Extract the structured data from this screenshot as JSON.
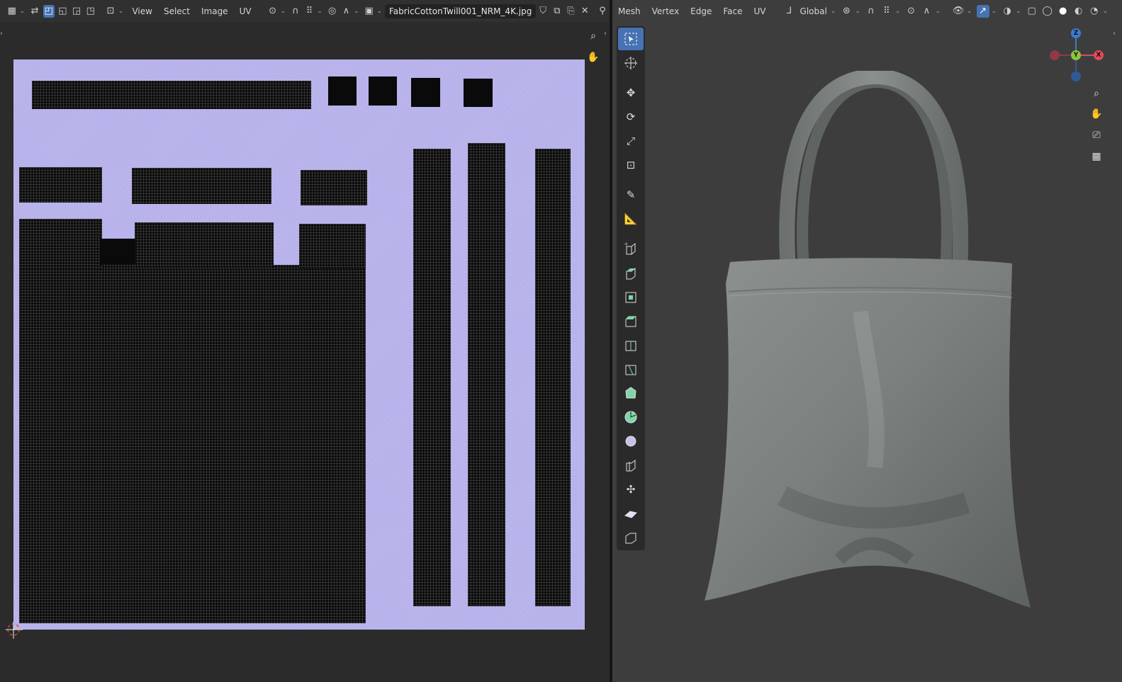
{
  "uv_editor": {
    "menus": [
      "View",
      "Select",
      "Image",
      "UV"
    ],
    "image_name": "FabricCottonTwill001_NRM_4K.jpg",
    "icons": [
      "editor-type-icon",
      "sync-selection-icon",
      "vertex-select-icon",
      "edge-select-icon",
      "face-select-icon",
      "island-select-icon",
      "sticky-selection-icon",
      "pivot-icon",
      "snap-icon",
      "proportional-edit-icon",
      "image-browse-icon",
      "fake-user-icon",
      "new-image-icon",
      "open-image-icon",
      "unlink-icon",
      "pin-icon"
    ],
    "nav": [
      "zoom-icon",
      "hand-pan-icon"
    ],
    "texture_color": "#b9b4ec",
    "uv_islands": "black mesh islands over fabric normal map"
  },
  "viewport": {
    "menus": [
      "Mesh",
      "Vertex",
      "Edge",
      "Face",
      "UV"
    ],
    "transform_orientation": "Global",
    "gizmo_axes": {
      "x": "X",
      "y": "Y",
      "z": "Z"
    },
    "axis_colors": {
      "x": "#e04a5a",
      "y": "#8cc43c",
      "z": "#3d7cd0"
    },
    "nav_icons": [
      "zoom-icon",
      "hand-pan-icon",
      "camera-icon",
      "grid-icon"
    ],
    "tools": [
      "select-box-icon",
      "cursor-icon",
      "move-icon",
      "rotate-icon",
      "scale-icon",
      "transform-icon",
      "annotate-icon",
      "measure-icon",
      "add-cube-icon",
      "extrude-icon",
      "inset-icon",
      "bevel-icon",
      "loop-cut-icon",
      "knife-icon",
      "poly-build-icon",
      "spin-icon",
      "smooth-icon",
      "edge-slide-icon",
      "shrink-fatten-icon",
      "shear-icon",
      "rip-icon"
    ],
    "object": "tote bag mesh",
    "bg_color": "#3d3d3d"
  }
}
